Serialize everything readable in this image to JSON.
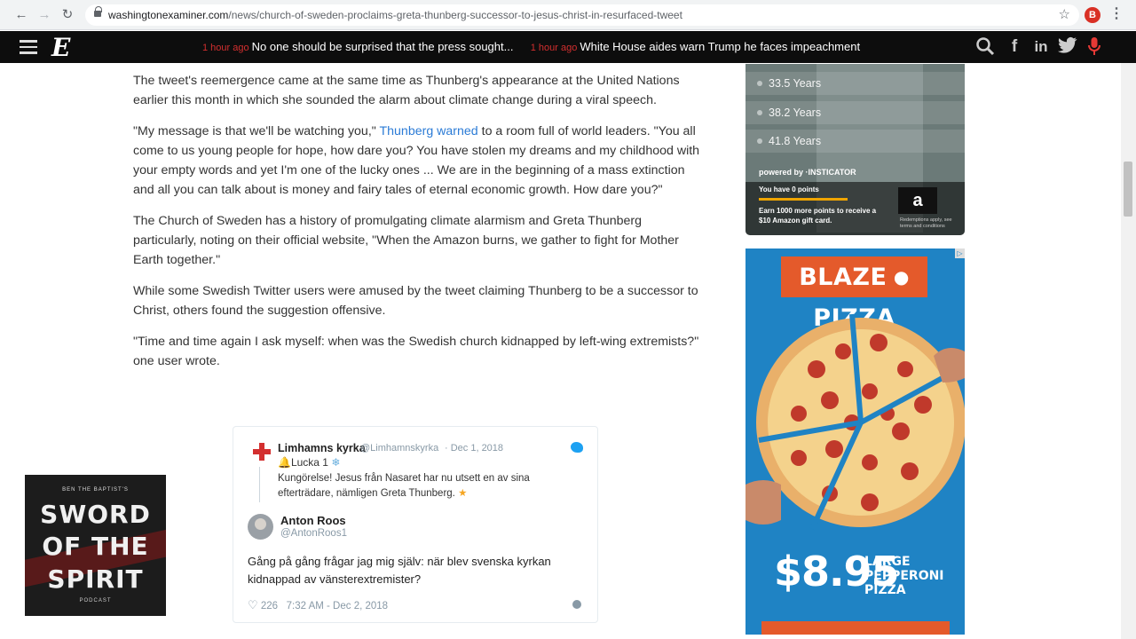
{
  "browser": {
    "url_host": "washingtonexaminer.com",
    "url_path": "/news/church-of-sweden-proclaims-greta-thunberg-successor-to-jesus-christ-in-resurfaced-tweet",
    "profile_initial": "B"
  },
  "header": {
    "logo": "E",
    "ticker": [
      {
        "time": "1 hour ago",
        "headline": "No one should be surprised that the press sought..."
      },
      {
        "time": "1 hour ago",
        "headline": "White House aides warn Trump he faces impeachment"
      }
    ],
    "icons": [
      "search-icon",
      "facebook-icon",
      "linkedin-icon",
      "twitter-icon",
      "microphone-icon"
    ]
  },
  "article": {
    "p1": "The tweet's reemergence came at the same time as Thunberg's appearance at the United Nations earlier this month in which she sounded the alarm about climate change during a viral speech.",
    "p2_before": "\"My message is that we'll be watching you,\" ",
    "p2_link": "Thunberg warned",
    "p2_after": " to a room full of world leaders. \"You all come to us young people for hope, how dare you? You have stolen my dreams and my childhood with your empty words and yet I'm one of the lucky ones ... We are in the beginning of a mass extinction and all you can talk about is money and fairy tales of eternal economic growth. How dare you?\"",
    "p3": "The Church of Sweden has a history of promulgating climate alarmism and Greta Thunberg particularly, noting on their official website, \"When the Amazon burns, we gather to fight for Mother Earth together.\"",
    "p4": "While some Swedish Twitter users were amused by the tweet claiming Thunberg to be a successor to Christ, others found the suggestion offensive.",
    "p5": "\"Time and time again I ask myself: when was the Swedish church kidnapped by left-wing extremists?\" one user wrote."
  },
  "tweet": {
    "quoted": {
      "name": "Limhamns kyrka",
      "handle": "@Limhamnskyrka",
      "date": "· Dec 1, 2018",
      "line1": "Lucka 1",
      "body": "Kungörelse! Jesus från Nasaret har nu utsett en av sina efterträdare, nämligen Greta Thunberg."
    },
    "reply": {
      "name": "Anton Roos",
      "handle": "@AntonRoos1",
      "text": "Gång på gång frågar jag mig själv: när blev svenska kyrkan kidnappad av vänsterextremister?",
      "likes": "226",
      "timestamp": "7:32 AM - Dec 2, 2018"
    }
  },
  "podcast": {
    "kicker": "BEN THE BAPTIST'S",
    "line1": "SWORD",
    "line2": "OF THE",
    "line3": "SPIRIT",
    "sub": "PODCAST"
  },
  "quiz": {
    "options": [
      "33.5 Years",
      "38.2 Years",
      "41.8 Years"
    ],
    "powered_by": "powered by ·INSTICATOR",
    "points": "You have 0 points",
    "earn": "Earn 1000 more points to receive a $10 Amazon gift card.",
    "amazon": "a",
    "fine_print": "Redemptions apply, see terms and conditions"
  },
  "ad": {
    "brand_left": "BLAZE",
    "brand_right": "PIZZA",
    "price": "$8.95",
    "desc_1": "LARGE",
    "desc_2": "PEPPERONI",
    "desc_3": "PIZZA",
    "adchoice": "▷"
  },
  "colors": {
    "link": "#2b7bd6",
    "ticker_time": "#d32f2f",
    "ad_bg": "#1f83c4",
    "blaze_orange": "#e45a2b"
  }
}
